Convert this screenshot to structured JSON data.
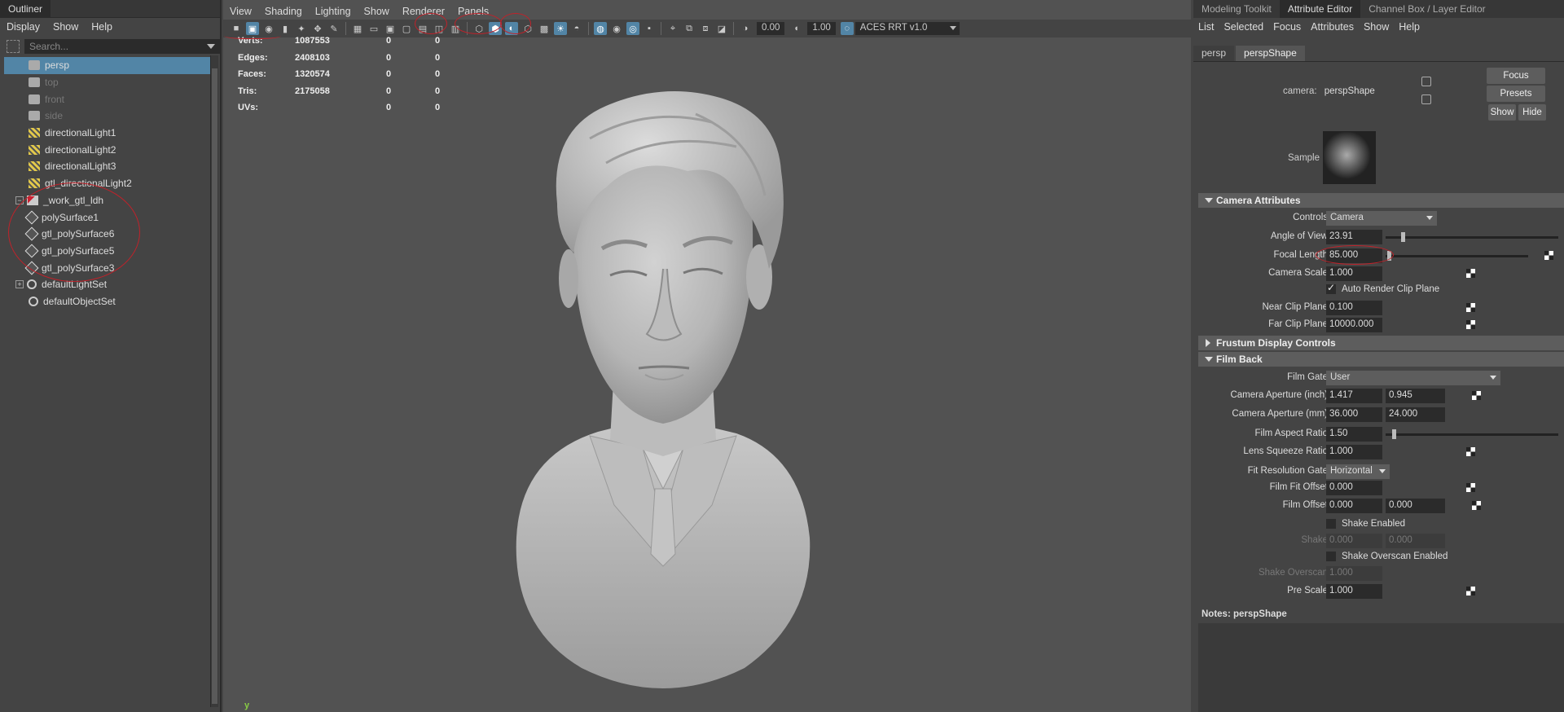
{
  "outliner": {
    "tab": "Outliner",
    "menu": [
      "Display",
      "Show",
      "Help"
    ],
    "search_placeholder": "Search...",
    "items": [
      {
        "label": "persp",
        "icon": "camera-icon",
        "selected": true
      },
      {
        "label": "top",
        "icon": "camera-icon",
        "dim": true
      },
      {
        "label": "front",
        "icon": "camera-icon",
        "dim": true
      },
      {
        "label": "side",
        "icon": "camera-icon",
        "dim": true
      },
      {
        "label": "directionalLight1",
        "icon": "light-icon"
      },
      {
        "label": "directionalLight2",
        "icon": "light-icon"
      },
      {
        "label": "directionalLight3",
        "icon": "light-icon"
      },
      {
        "label": "gtl_directionalLight2",
        "icon": "light-icon"
      },
      {
        "label": "_work_gtl_ldh",
        "icon": "group-icon",
        "expander": "−"
      },
      {
        "label": "polySurface1",
        "icon": "mesh-icon",
        "child": true
      },
      {
        "label": "gtl_polySurface6",
        "icon": "mesh-icon",
        "child": true
      },
      {
        "label": "gtl_polySurface5",
        "icon": "mesh-icon",
        "child": true
      },
      {
        "label": "gtl_polySurface3",
        "icon": "mesh-icon",
        "child": true
      },
      {
        "label": "defaultLightSet",
        "icon": "set-icon",
        "expander": "+"
      },
      {
        "label": "defaultObjectSet",
        "icon": "set-icon"
      }
    ]
  },
  "viewport": {
    "menu": [
      "View",
      "Shading",
      "Lighting",
      "Show",
      "Renderer",
      "Panels"
    ],
    "toolbar": {
      "exposure": "0.00",
      "gamma": "1.00",
      "color_space": "ACES RRT v1.0"
    },
    "hud": [
      {
        "label": "Verts:",
        "v1": "1087553",
        "v2": "0",
        "v3": "0"
      },
      {
        "label": "Edges:",
        "v1": "2408103",
        "v2": "0",
        "v3": "0"
      },
      {
        "label": "Faces:",
        "v1": "1320574",
        "v2": "0",
        "v3": "0"
      },
      {
        "label": "Tris:",
        "v1": "2175058",
        "v2": "0",
        "v3": "0"
      },
      {
        "label": "UVs:",
        "v1": "",
        "v2": "0",
        "v3": "0"
      }
    ],
    "axis_label": "y"
  },
  "attr_editor": {
    "tabs": [
      "Modeling Toolkit",
      "Attribute Editor",
      "Channel Box / Layer Editor"
    ],
    "menu": [
      "List",
      "Selected",
      "Focus",
      "Attributes",
      "Show",
      "Help"
    ],
    "node_tabs": [
      "persp",
      "perspShape"
    ],
    "camera_label": "camera:",
    "camera_value": "perspShape",
    "buttons": {
      "focus": "Focus",
      "presets": "Presets",
      "show": "Show",
      "hide": "Hide"
    },
    "sample_label": "Sample",
    "sections": {
      "camera_attributes": "Camera Attributes",
      "frustum": "Frustum Display Controls",
      "film_back": "Film Back"
    },
    "camera_attrs": {
      "controls_label": "Controls",
      "controls_value": "Camera",
      "aov_label": "Angle of View",
      "aov_value": "23.91",
      "aov_fraction": 0.09,
      "focal_label": "Focal Length",
      "focal_value": "85.000",
      "focal_fraction": 0.01,
      "scale_label": "Camera Scale",
      "scale_value": "1.000",
      "auto_clip_label": "Auto Render Clip Plane",
      "near_label": "Near Clip Plane",
      "near_value": "0.100",
      "far_label": "Far Clip Plane",
      "far_value": "10000.000"
    },
    "film_back": {
      "gate_label": "Film Gate",
      "gate_value": "User",
      "ap_inch_label": "Camera Aperture (inch)",
      "ap_inch_1": "1.417",
      "ap_inch_2": "0.945",
      "ap_mm_label": "Camera Aperture (mm)",
      "ap_mm_1": "36.000",
      "ap_mm_2": "24.000",
      "aspect_label": "Film Aspect Ratio",
      "aspect_value": "1.50",
      "aspect_fraction": 0.04,
      "squeeze_label": "Lens Squeeze Ratio",
      "squeeze_value": "1.000",
      "fit_label": "Fit Resolution Gate",
      "fit_value": "Horizontal",
      "fit_offset_label": "Film Fit Offset",
      "fit_offset_value": "0.000",
      "film_offset_label": "Film Offset",
      "film_offset_1": "0.000",
      "film_offset_2": "0.000",
      "shake_enabled_label": "Shake Enabled",
      "shake_label": "Shake",
      "shake_1": "0.000",
      "shake_2": "0.000",
      "shake_overscan_enabled_label": "Shake Overscan Enabled",
      "shake_overscan_label": "Shake Overscan",
      "shake_overscan_value": "1.000",
      "pre_scale_label": "Pre Scale",
      "pre_scale_value": "1.000"
    },
    "notes_label": "Notes:",
    "notes_node": "perspShape"
  },
  "colors": {
    "selection": "#5285a6",
    "annotation": "#c0222a",
    "panel": "#444444",
    "viewport": "#525252"
  }
}
